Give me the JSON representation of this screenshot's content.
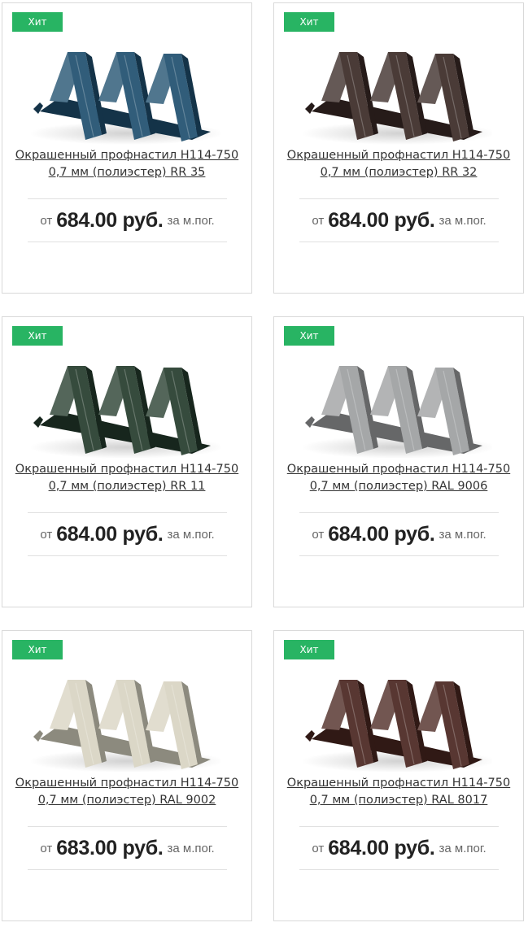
{
  "products": [
    {
      "badge": "Хит",
      "title": "Окрашенный профнастил Н114-750 0,7 мм (полиэстер) RR 35",
      "price_prefix": "от",
      "price": "684.00 руб.",
      "unit": "за м.пог.",
      "color": "#1f4f6e",
      "color_name": "blue"
    },
    {
      "badge": "Хит",
      "title": "Окрашенный профнастил Н114-750 0,7 мм (полиэстер) RR 32",
      "price_prefix": "от",
      "price": "684.00 руб.",
      "unit": "за м.пог.",
      "color": "#3a2a26",
      "color_name": "dark-brown"
    },
    {
      "badge": "Хит",
      "title": "Окрашенный профнастил Н114-750 0,7 мм (полиэстер) RR 11",
      "price_prefix": "от",
      "price": "684.00 руб.",
      "unit": "за м.пог.",
      "color": "#243b2c",
      "color_name": "dark-green"
    },
    {
      "badge": "Хит",
      "title": "Окрашенный профнастил Н114-750 0,7 мм (полиэстер) RAL 9006",
      "price_prefix": "от",
      "price": "684.00 руб.",
      "unit": "за м.пог.",
      "color": "#9d9fa0",
      "color_name": "silver"
    },
    {
      "badge": "Хит",
      "title": "Окрашенный профнастил Н114-750 0,7 мм (полиэстер) RAL 9002",
      "price_prefix": "от",
      "price": "683.00 руб.",
      "unit": "за м.пог.",
      "color": "#d8d4c2",
      "color_name": "grey-white"
    },
    {
      "badge": "Хит",
      "title": "Окрашенный профнастил Н114-750 0,7 мм (полиэстер) RAL 8017",
      "price_prefix": "от",
      "price": "684.00 руб.",
      "unit": "за м.пог.",
      "color": "#4a2620",
      "color_name": "chocolate-brown"
    }
  ],
  "colors": {
    "badge": "#28b463",
    "border": "#d9d9d9",
    "text": "#333333"
  }
}
